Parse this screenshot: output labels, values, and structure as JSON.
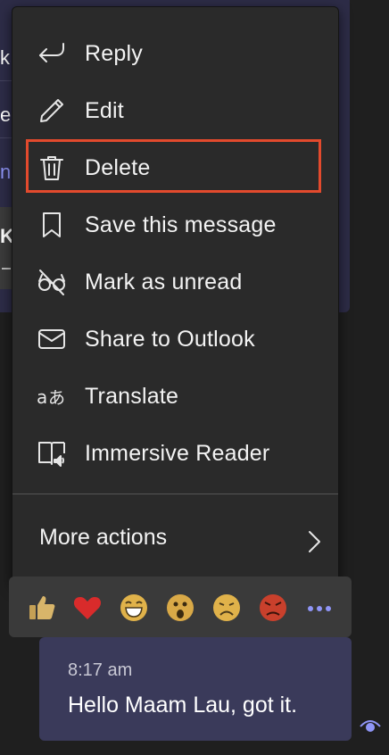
{
  "menu": {
    "items": [
      {
        "label": "Reply",
        "icon": "reply-icon"
      },
      {
        "label": "Edit",
        "icon": "pencil-icon"
      },
      {
        "label": "Delete",
        "icon": "trash-icon"
      },
      {
        "label": "Save this message",
        "icon": "bookmark-icon"
      },
      {
        "label": "Mark as unread",
        "icon": "unread-glasses-icon"
      },
      {
        "label": "Share to Outlook",
        "icon": "mail-icon"
      },
      {
        "label": "Translate",
        "icon": "translate-icon"
      },
      {
        "label": "Immersive Reader",
        "icon": "immersive-reader-icon"
      }
    ],
    "more_actions_label": "More actions",
    "highlight_color": "#e34a2d"
  },
  "reactions": [
    "like",
    "heart",
    "laugh",
    "surprised",
    "sad",
    "angry",
    "more"
  ],
  "sent_message": {
    "time": "8:17 am",
    "text": "Hello Maam Lau, got it."
  },
  "colors": {
    "menu_bg": "#2a2a2a",
    "accent": "#7f85f5",
    "bubble_bg": "#3a3a5a"
  }
}
